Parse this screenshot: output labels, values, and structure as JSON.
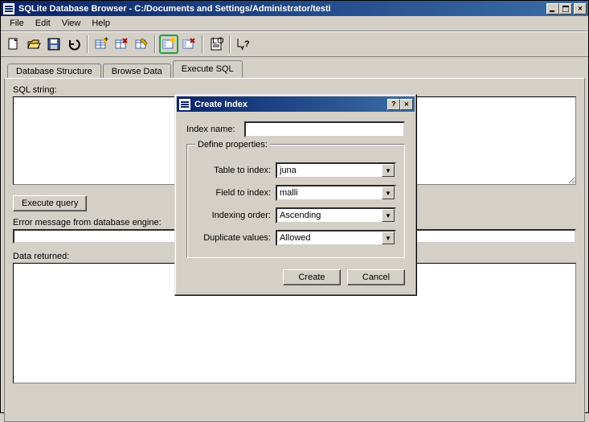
{
  "window": {
    "title": "SQLite Database Browser - C:/Documents and Settings/Administrator/testi"
  },
  "menu": {
    "file": "File",
    "edit": "Edit",
    "view": "View",
    "help": "Help"
  },
  "tabs": {
    "structure": "Database Structure",
    "browse": "Browse Data",
    "execute": "Execute SQL"
  },
  "main": {
    "sql_string_label": "SQL string:",
    "execute_query_btn": "Execute query",
    "error_label": "Error message from database engine:",
    "data_returned_label": "Data returned:"
  },
  "dialog": {
    "title": "Create Index",
    "index_name_label": "Index name:",
    "index_name_value": "",
    "define_properties_legend": "Define properties:",
    "table_to_index_label": "Table to index:",
    "table_to_index_value": "juna",
    "field_to_index_label": "Field to index:",
    "field_to_index_value": "malli",
    "indexing_order_label": "Indexing order:",
    "indexing_order_value": "Ascending",
    "duplicate_values_label": "Duplicate values:",
    "duplicate_values_value": "Allowed",
    "create_btn": "Create",
    "cancel_btn": "Cancel"
  }
}
